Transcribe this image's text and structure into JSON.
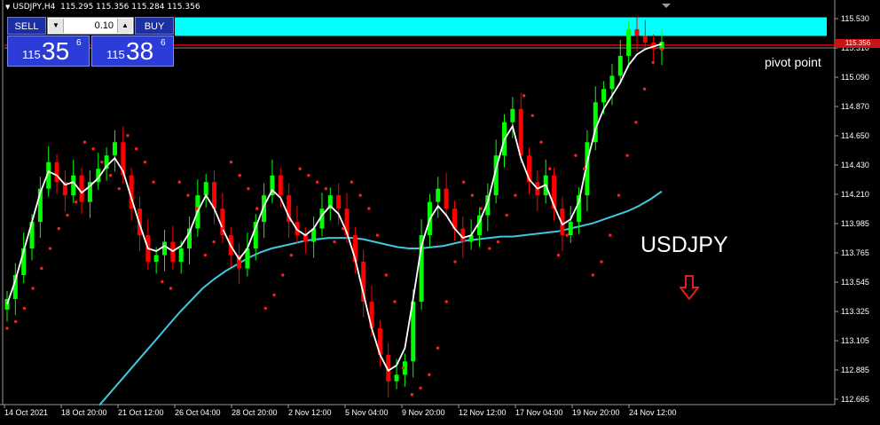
{
  "header": {
    "symbol_timeframe": "USDJPY,H4",
    "ohlc": "115.295 115.356 115.284 115.356"
  },
  "trade_panel": {
    "sell_label": "SELL",
    "buy_label": "BUY",
    "lot_value": "0.10",
    "sell_price": {
      "prefix": "115",
      "big": "35",
      "sup": "6"
    },
    "buy_price": {
      "prefix": "115",
      "big": "38",
      "sup": "6"
    }
  },
  "price_axis": {
    "ticks": [
      "115.530",
      "115.310",
      "115.090",
      "114.870",
      "114.650",
      "114.430",
      "114.210",
      "113.985",
      "113.765",
      "113.545",
      "113.325",
      "113.105",
      "112.885",
      "112.665"
    ],
    "current_price_label": "115.356"
  },
  "time_axis": {
    "ticks": [
      "14 Oct 2021",
      "18 Oct 20:00",
      "21 Oct 12:00",
      "26 Oct 04:00",
      "28 Oct 20:00",
      "2 Nov 12:00",
      "5 Nov 04:00",
      "9 Nov 20:00",
      "12 Nov 12:00",
      "17 Nov 04:00",
      "19 Nov 20:00",
      "24 Nov 12:00"
    ]
  },
  "annotations": {
    "pivot_label": "pivot point",
    "symbol_label": "USDJPY"
  },
  "colors": {
    "background": "#000000",
    "bull_candle": "#00ff00",
    "bear_candle": "#ff0000",
    "sar_dots": "#ff1e1e",
    "fast_ma": "#ffffff",
    "slow_ma": "#40c8e0",
    "zone": "#00ffff",
    "pivot_line": "#ff0000",
    "arrow": "#e02020"
  },
  "chart_data": {
    "type": "candlestick",
    "symbol": "USDJPY",
    "timeframe": "H4",
    "ylim": [
      112.665,
      115.6
    ],
    "current_price": 115.356,
    "resistance_zone": [
      115.4,
      115.54
    ],
    "pivot_line": 115.33,
    "close_series": [
      113.42,
      113.6,
      113.8,
      114.0,
      114.25,
      114.45,
      114.3,
      114.2,
      114.35,
      114.15,
      114.3,
      114.4,
      114.5,
      114.6,
      114.35,
      114.1,
      113.9,
      113.7,
      113.75,
      113.85,
      113.7,
      113.8,
      113.95,
      114.2,
      114.3,
      114.1,
      113.9,
      113.75,
      113.65,
      113.8,
      114.0,
      114.2,
      114.35,
      114.2,
      114.0,
      113.9,
      113.85,
      113.95,
      114.1,
      114.2,
      114.1,
      113.9,
      113.7,
      113.4,
      113.2,
      113.0,
      112.8,
      112.85,
      112.95,
      113.4,
      113.9,
      114.15,
      114.25,
      114.1,
      113.95,
      113.85,
      113.9,
      114.05,
      114.2,
      114.5,
      114.75,
      114.85,
      114.5,
      114.3,
      114.2,
      114.35,
      114.1,
      113.9,
      114.0,
      114.2,
      114.6,
      114.9,
      115.0,
      115.1,
      115.25,
      115.45,
      115.4,
      115.35,
      115.3,
      115.356
    ],
    "fast_ma_series": [
      113.38,
      113.56,
      113.78,
      114.0,
      114.22,
      114.38,
      114.35,
      114.28,
      114.3,
      114.22,
      114.27,
      114.33,
      114.42,
      114.48,
      114.38,
      114.18,
      113.98,
      113.8,
      113.78,
      113.82,
      113.78,
      113.82,
      113.92,
      114.08,
      114.2,
      114.1,
      113.95,
      113.82,
      113.72,
      113.8,
      113.96,
      114.12,
      114.24,
      114.18,
      114.04,
      113.94,
      113.9,
      113.95,
      114.05,
      114.12,
      114.06,
      113.92,
      113.72,
      113.46,
      113.2,
      113.0,
      112.88,
      112.92,
      113.05,
      113.42,
      113.82,
      114.02,
      114.12,
      114.05,
      113.95,
      113.88,
      113.9,
      114.0,
      114.15,
      114.4,
      114.62,
      114.72,
      114.48,
      114.32,
      114.25,
      114.28,
      114.12,
      113.98,
      114.02,
      114.15,
      114.45,
      114.7,
      114.85,
      114.95,
      115.05,
      115.18,
      115.26,
      115.3,
      115.32,
      115.34
    ],
    "slow_ma_series": [
      112.62,
      112.72,
      112.82,
      112.92,
      113.02,
      113.12,
      113.22,
      113.32,
      113.41,
      113.5,
      113.57,
      113.63,
      113.68,
      113.73,
      113.77,
      113.8,
      113.82,
      113.84,
      113.86,
      113.87,
      113.88,
      113.88,
      113.88,
      113.87,
      113.85,
      113.83,
      113.81,
      113.8,
      113.8,
      113.81,
      113.82,
      113.84,
      113.86,
      113.87,
      113.88,
      113.89,
      113.89,
      113.9,
      113.91,
      113.92,
      113.93,
      113.95,
      113.97,
      113.99,
      114.02,
      114.05,
      114.08,
      114.12,
      114.17,
      114.23
    ],
    "parabolic_sar_series": [
      113.2,
      113.25,
      113.35,
      113.5,
      113.65,
      113.8,
      113.95,
      114.05,
      114.15,
      114.6,
      114.55,
      114.45,
      114.35,
      114.25,
      114.65,
      114.55,
      114.45,
      114.3,
      113.55,
      113.5,
      114.3,
      114.2,
      114.1,
      113.75,
      113.85,
      113.95,
      114.45,
      114.35,
      114.25,
      114.1,
      113.35,
      113.45,
      113.6,
      113.75,
      114.4,
      114.35,
      114.3,
      114.25,
      113.85,
      113.95,
      114.3,
      114.2,
      114.1,
      113.9,
      113.6,
      113.4,
      112.9,
      112.7,
      112.75,
      112.85,
      113.05,
      113.4,
      113.7,
      114.3,
      114.2,
      114.1,
      113.8,
      113.85,
      114.05,
      114.2,
      114.95,
      114.8,
      114.6,
      114.4,
      113.75,
      113.9,
      114.5,
      114.4,
      113.6,
      113.7,
      113.9,
      114.2,
      114.5,
      114.75,
      115.0,
      115.2,
      115.3
    ]
  }
}
